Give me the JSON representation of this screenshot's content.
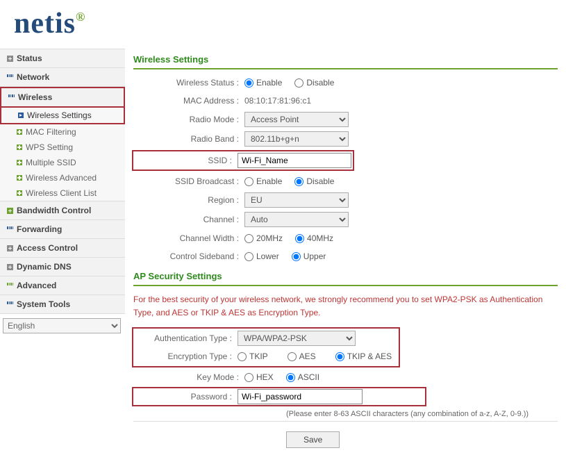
{
  "logo": "netis",
  "language": "English",
  "sidebar": {
    "items": [
      {
        "label": "Status",
        "type": "plus"
      },
      {
        "label": "Network",
        "type": "dots"
      },
      {
        "label": "Wireless",
        "type": "dots",
        "expanded": true,
        "children": [
          {
            "label": "Wireless Settings",
            "active": true
          },
          {
            "label": "MAC Filtering"
          },
          {
            "label": "WPS Setting"
          },
          {
            "label": "Multiple SSID"
          },
          {
            "label": "Wireless Advanced"
          },
          {
            "label": "Wireless Client List"
          }
        ]
      },
      {
        "label": "Bandwidth Control",
        "type": "green-plus"
      },
      {
        "label": "Forwarding",
        "type": "dots"
      },
      {
        "label": "Access Control",
        "type": "plus"
      },
      {
        "label": "Dynamic DNS",
        "type": "plus"
      },
      {
        "label": "Advanced",
        "type": "dots-green"
      },
      {
        "label": "System Tools",
        "type": "dots"
      }
    ]
  },
  "wireless_settings": {
    "title": "Wireless Settings",
    "wireless_status_label": "Wireless Status :",
    "enable": "Enable",
    "disable": "Disable",
    "mac_address_label": "MAC Address :",
    "mac_address_value": "08:10:17:81:96:c1",
    "radio_mode_label": "Radio Mode :",
    "radio_mode_value": "Access Point",
    "radio_band_label": "Radio Band :",
    "radio_band_value": "802.11b+g+n",
    "ssid_label": "SSID :",
    "ssid_value": "Wi-Fi_Name",
    "ssid_broadcast_label": "SSID Broadcast :",
    "region_label": "Region :",
    "region_value": "EU",
    "channel_label": "Channel :",
    "channel_value": "Auto",
    "channel_width_label": "Channel Width :",
    "cw_20": "20MHz",
    "cw_40": "40MHz",
    "control_sideband_label": "Control Sideband :",
    "cs_lower": "Lower",
    "cs_upper": "Upper"
  },
  "security": {
    "title": "AP Security Settings",
    "recommend": "For the best security of your wireless network, we strongly recommend you to set WPA2-PSK as Authentication Type, and AES or TKIP & AES as Encryption Type.",
    "auth_type_label": "Authentication Type :",
    "auth_type_value": "WPA/WPA2-PSK",
    "enc_type_label": "Encryption Type :",
    "enc_tkip": "TKIP",
    "enc_aes": "AES",
    "enc_both": "TKIP & AES",
    "key_mode_label": "Key Mode :",
    "key_hex": "HEX",
    "key_ascii": "ASCII",
    "password_label": "Password :",
    "password_value": "Wi-Fi_password",
    "hint": "(Please enter 8-63 ASCII characters (any combination of a-z, A-Z, 0-9.))",
    "save": "Save"
  }
}
